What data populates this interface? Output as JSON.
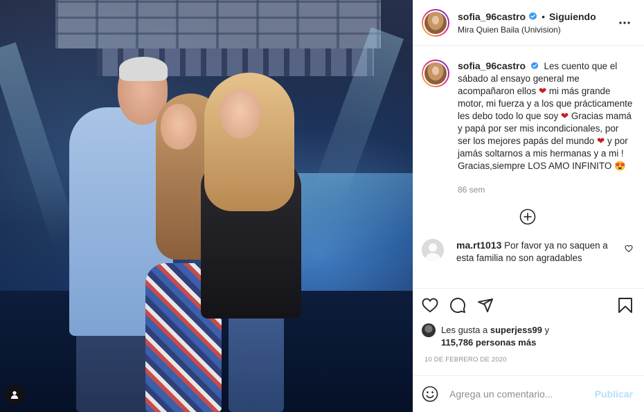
{
  "header": {
    "username": "sofia_96castro",
    "separator": "•",
    "follow_state": "Siguiendo",
    "location": "Mira Quien Baila (Univision)"
  },
  "caption": {
    "username": "sofia_96castro",
    "text_1": "Les cuento que el sábado al ensayo general me acompañaron ellos",
    "heart_1": "❤",
    "text_2": "mi más grande motor, mi fuerza y a los que prácticamente les debo todo lo que soy",
    "heart_2": "❤",
    "text_3": "Gracias mamá y papá por ser mis incondicionales, por ser los mejores papás del mundo",
    "hearts_3": "❤",
    "text_4": "y por jamás soltarnos a mis hermanas y a mi ! Gracias,siempre LOS AMO INFINITO",
    "emoji_4": "😍",
    "time": "86 sem"
  },
  "comments": [
    {
      "username": "ma.rt1013",
      "text": "Por favor ya no saquen a esta familia no son agradables"
    }
  ],
  "likes": {
    "prefix": "Les gusta a",
    "user": "superjess99",
    "conjunction": "y",
    "count": "115,786 personas más"
  },
  "date": "10 DE FEBRERO DE 2020",
  "add_comment": {
    "placeholder": "Agrega un comentario...",
    "post_label": "Publicar"
  },
  "colors": {
    "verified": "#3897f0",
    "heart": "#c81e1e",
    "post_disabled": "#b2dffc"
  },
  "icons": [
    "user-tag-icon",
    "verified-icon",
    "more-options-icon",
    "load-more-icon",
    "like-icon",
    "comment-icon",
    "share-icon",
    "save-icon",
    "emoji-icon",
    "comment-like-icon"
  ]
}
